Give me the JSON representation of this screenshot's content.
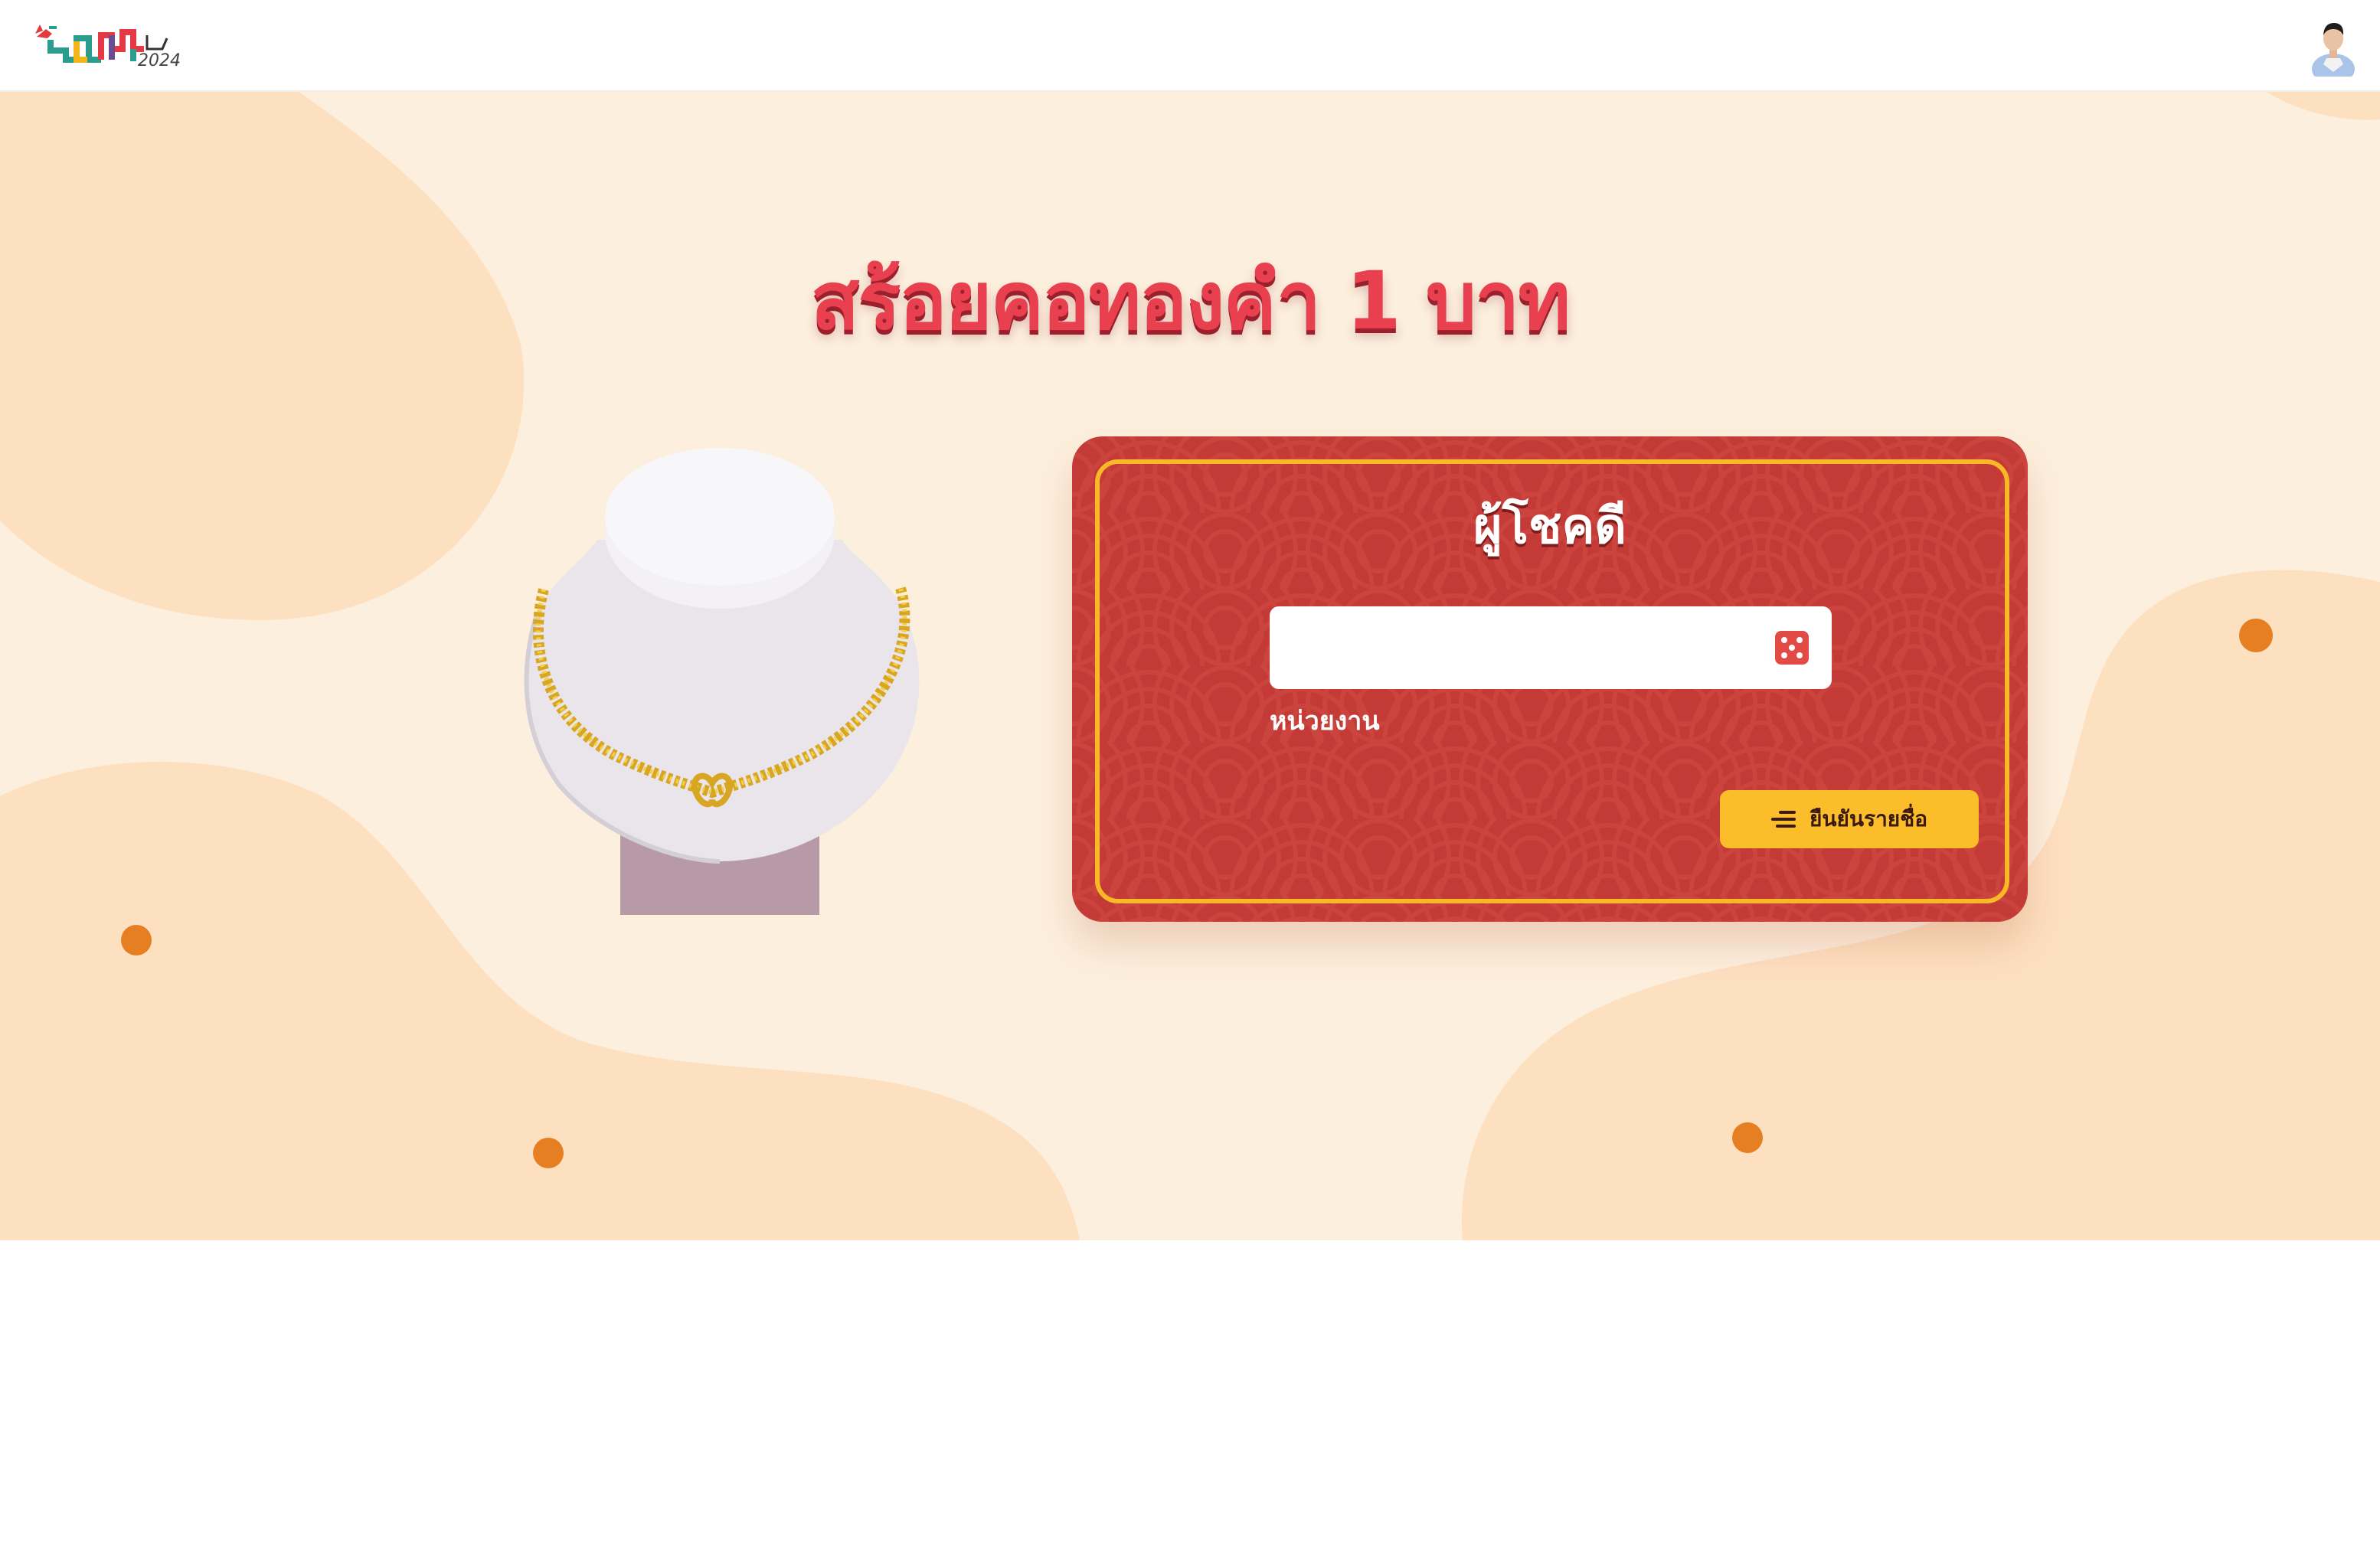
{
  "header": {
    "logo_icon": "event-logo-2024",
    "avatar_icon": "user-avatar"
  },
  "main": {
    "prize_title": "สร้อยคอทองคำ 1 บาท",
    "prize_image_icon": "gold-necklace-on-bust"
  },
  "card": {
    "heading": "ผู้โชคดี",
    "winner_input": {
      "value": "",
      "placeholder": ""
    },
    "random_icon": "dice-icon",
    "department_label": "หน่วยงาน",
    "confirm_button": {
      "label": "ยืนยันรายชื่อ",
      "icon": "list-icon"
    }
  },
  "colors": {
    "background": "#fdefdd",
    "blob": "#fde0c0",
    "dot": "#e67e22",
    "card": "#c43a36",
    "card_border": "#f9b825",
    "title": "#e8404f",
    "button": "#fbbd2a"
  }
}
